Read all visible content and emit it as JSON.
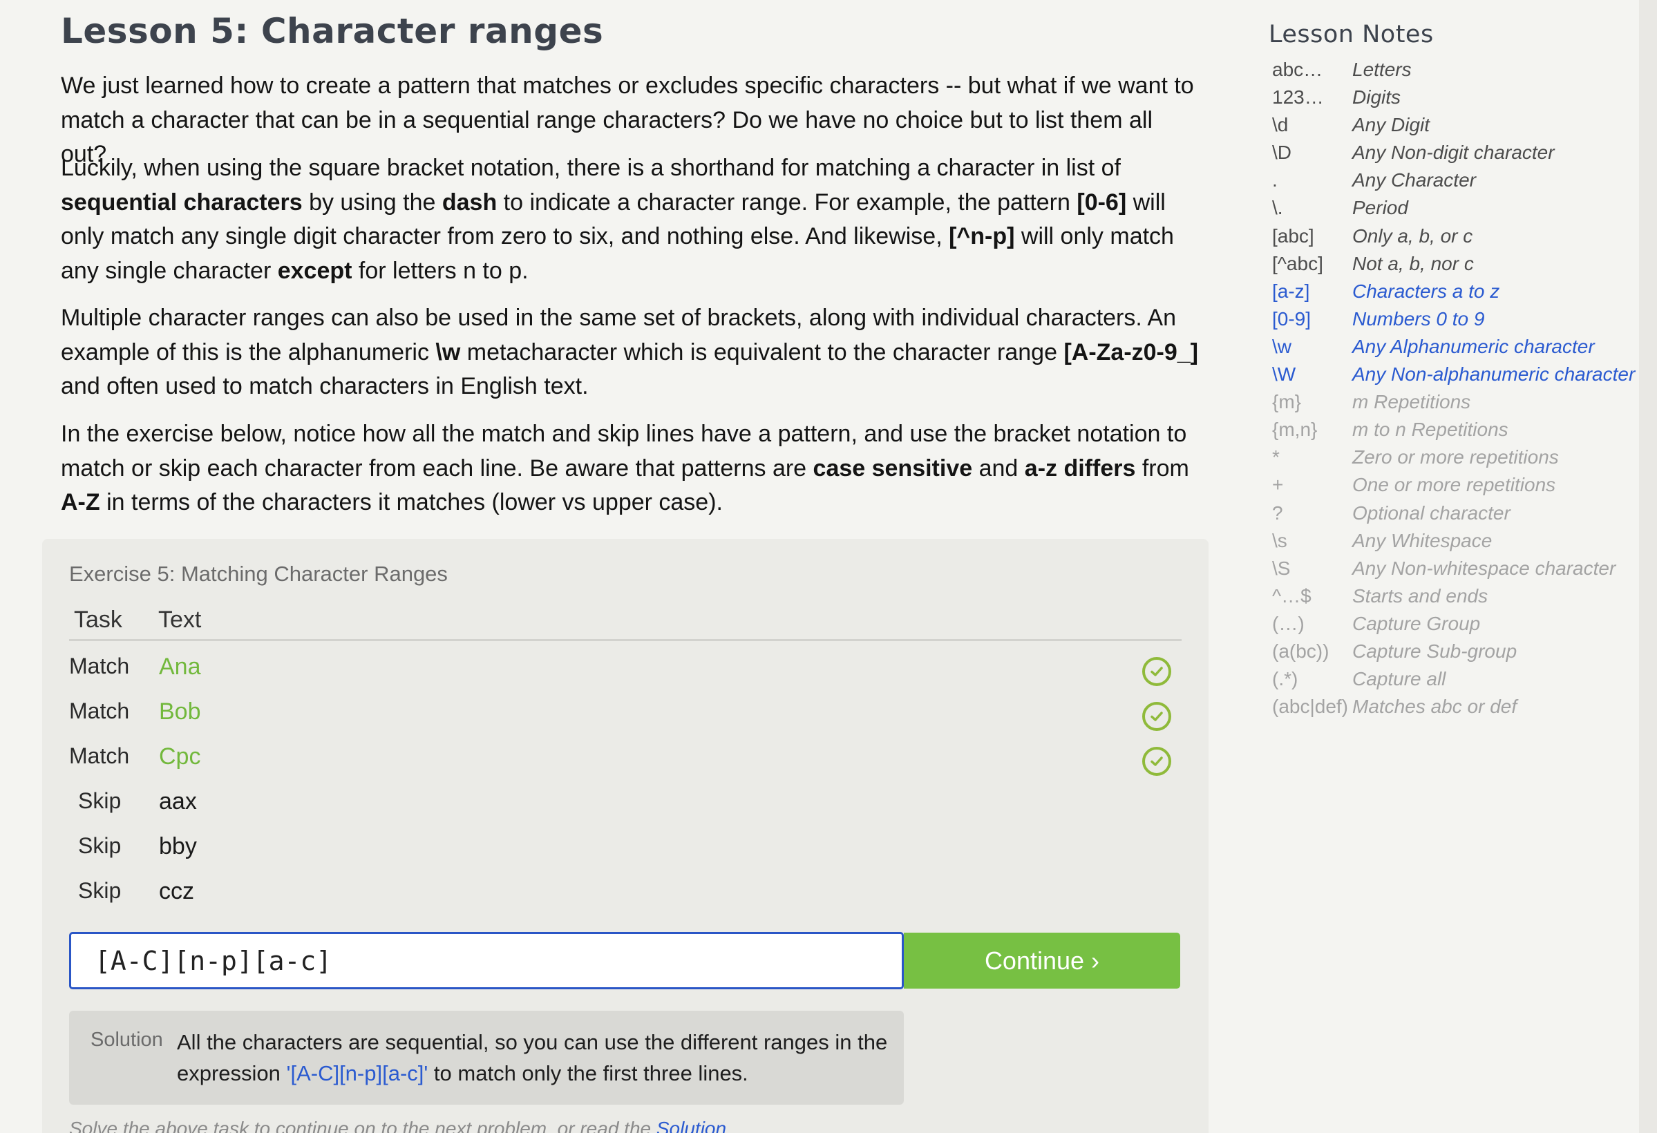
{
  "lesson": {
    "title": "Lesson 5: Character ranges",
    "paragraphs": [
      [
        {
          "t": "We just learned how to create a pattern that matches or excludes specific characters -- but what if we want to match a character that can be in a sequential range characters? Do we have no choice but to list them all out?",
          "b": false
        }
      ],
      [
        {
          "t": "Luckily, when using the square bracket notation, there is a shorthand for matching a character in list of ",
          "b": false
        },
        {
          "t": "sequential characters",
          "b": true
        },
        {
          "t": " by using the ",
          "b": false
        },
        {
          "t": "dash",
          "b": true
        },
        {
          "t": " to indicate a character range. For example, the pattern ",
          "b": false
        },
        {
          "t": "[0-6]",
          "b": true
        },
        {
          "t": " will only match any single digit character from zero to six, and nothing else. And likewise, ",
          "b": false
        },
        {
          "t": "[^n-p]",
          "b": true
        },
        {
          "t": " will only match any single character ",
          "b": false
        },
        {
          "t": "except",
          "b": true
        },
        {
          "t": " for letters n to p.",
          "b": false
        }
      ],
      [
        {
          "t": "Multiple character ranges can also be used in the same set of brackets, along with individual characters. An example of this is the alphanumeric ",
          "b": false
        },
        {
          "t": "\\w",
          "b": true
        },
        {
          "t": " metacharacter which is equivalent to the character range ",
          "b": false
        },
        {
          "t": "[A-Za-z0-9_]",
          "b": true
        },
        {
          "t": " and often used to match characters in English text.",
          "b": false
        }
      ],
      [
        {
          "t": "In the exercise below, notice how all the match and skip lines have a pattern, and use the bracket notation to match or skip each character from each line. Be aware that patterns are ",
          "b": false
        },
        {
          "t": "case sensitive",
          "b": true
        },
        {
          "t": " and ",
          "b": false
        },
        {
          "t": "a-z differs",
          "b": true
        },
        {
          "t": " from ",
          "b": false
        },
        {
          "t": "A-Z",
          "b": true
        },
        {
          "t": " in terms of the characters it matches (lower vs upper case).",
          "b": false
        }
      ]
    ]
  },
  "exercise": {
    "title": "Exercise 5: Matching Character Ranges",
    "header_task": "Task",
    "header_text": "Text",
    "rows": [
      {
        "task": "Match",
        "text": "Ana",
        "matched": true
      },
      {
        "task": "Match",
        "text": "Bob",
        "matched": true
      },
      {
        "task": "Match",
        "text": "Cpc",
        "matched": true
      },
      {
        "task": "Skip",
        "text": "aax",
        "matched": false
      },
      {
        "task": "Skip",
        "text": "bby",
        "matched": false
      },
      {
        "task": "Skip",
        "text": "ccz",
        "matched": false
      }
    ],
    "input_value": "[A-C][n-p][a-c]",
    "continue_label": "Continue ›",
    "solution_label": "Solution",
    "solution_text_before": "All the characters are sequential, so you can use the different ranges in the expression ",
    "solution_code": "'[A-C][n-p][a-c]'",
    "solution_text_after": " to match only the first three lines.",
    "footnote_before": "Solve the above task to continue on to the next problem, or read the ",
    "footnote_link": "Solution",
    "footnote_after": "."
  },
  "notes": {
    "title": "Lesson Notes",
    "items": [
      {
        "k": "abc…",
        "v": "Letters",
        "state": "learned"
      },
      {
        "k": "123…",
        "v": "Digits",
        "state": "learned"
      },
      {
        "k": "\\d",
        "v": "Any Digit",
        "state": "learned"
      },
      {
        "k": "\\D",
        "v": "Any Non-digit character",
        "state": "learned"
      },
      {
        "k": ".",
        "v": "Any Character",
        "state": "learned"
      },
      {
        "k": "\\.",
        "v": "Period",
        "state": "learned"
      },
      {
        "k": "[abc]",
        "v": "Only a, b, or c",
        "state": "learned"
      },
      {
        "k": "[^abc]",
        "v": "Not a, b, nor c",
        "state": "learned"
      },
      {
        "k": "[a-z]",
        "v": "Characters a to z",
        "state": "current"
      },
      {
        "k": "[0-9]",
        "v": "Numbers 0 to 9",
        "state": "current"
      },
      {
        "k": "\\w",
        "v": "Any Alphanumeric character",
        "state": "current"
      },
      {
        "k": "\\W",
        "v": "Any Non-alphanumeric character",
        "state": "current"
      },
      {
        "k": "{m}",
        "v": "m Repetitions",
        "state": "future"
      },
      {
        "k": "{m,n}",
        "v": "m to n Repetitions",
        "state": "future"
      },
      {
        "k": "*",
        "v": "Zero or more repetitions",
        "state": "future"
      },
      {
        "k": "+",
        "v": "One or more repetitions",
        "state": "future"
      },
      {
        "k": "?",
        "v": "Optional character",
        "state": "future"
      },
      {
        "k": "\\s",
        "v": "Any Whitespace",
        "state": "future"
      },
      {
        "k": "\\S",
        "v": "Any Non-whitespace character",
        "state": "future"
      },
      {
        "k": "^…$",
        "v": "Starts and ends",
        "state": "future"
      },
      {
        "k": "(…)",
        "v": "Capture Group",
        "state": "future"
      },
      {
        "k": "(a(bc))",
        "v": "Capture Sub-group",
        "state": "future"
      },
      {
        "k": "(.*)",
        "v": "Capture all",
        "state": "future"
      },
      {
        "k": "(abc|def)",
        "v": "Matches abc or def",
        "state": "future"
      }
    ]
  }
}
